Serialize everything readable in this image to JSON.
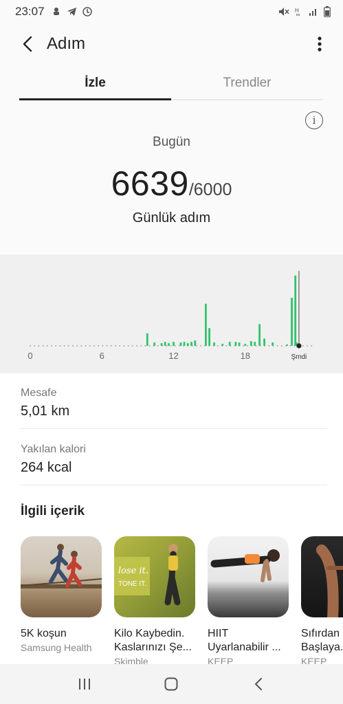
{
  "status_bar": {
    "time": "23:07"
  },
  "header": {
    "title": "Adım"
  },
  "tabs": [
    {
      "label": "İzle"
    },
    {
      "label": "Trendler"
    }
  ],
  "summary": {
    "today_label": "Bugün",
    "steps": "6639",
    "goal": "/6000",
    "subtitle": "Günlük adım"
  },
  "chart_data": {
    "type": "bar",
    "x_ticks": [
      "0",
      "6",
      "12",
      "18",
      "Şmdi"
    ],
    "x_tick_hours": [
      0,
      6,
      12,
      18,
      22.5
    ],
    "hour_range": [
      0,
      24
    ],
    "now_hour": 22.5,
    "bars": [
      {
        "hour": 9.8,
        "value": 19
      },
      {
        "hour": 10.4,
        "value": 5
      },
      {
        "hour": 11.0,
        "value": 4
      },
      {
        "hour": 11.3,
        "value": 6
      },
      {
        "hour": 11.6,
        "value": 4
      },
      {
        "hour": 12.0,
        "value": 6
      },
      {
        "hour": 12.6,
        "value": 5
      },
      {
        "hour": 12.9,
        "value": 6
      },
      {
        "hour": 13.2,
        "value": 4
      },
      {
        "hour": 13.5,
        "value": 6
      },
      {
        "hour": 13.8,
        "value": 8
      },
      {
        "hour": 14.7,
        "value": 64
      },
      {
        "hour": 15.0,
        "value": 27
      },
      {
        "hour": 15.4,
        "value": 5
      },
      {
        "hour": 16.1,
        "value": 3
      },
      {
        "hour": 16.7,
        "value": 6
      },
      {
        "hour": 17.2,
        "value": 6
      },
      {
        "hour": 17.5,
        "value": 5
      },
      {
        "hour": 18.0,
        "value": 3
      },
      {
        "hour": 18.5,
        "value": 7
      },
      {
        "hour": 18.8,
        "value": 6
      },
      {
        "hour": 19.2,
        "value": 33
      },
      {
        "hour": 19.6,
        "value": 11
      },
      {
        "hour": 20.3,
        "value": 5
      },
      {
        "hour": 21.5,
        "value": 2
      },
      {
        "hour": 21.9,
        "value": 73
      },
      {
        "hour": 22.2,
        "value": 107
      },
      {
        "hour": 22.3,
        "value": 5
      }
    ],
    "bar_color": "#2ec46a"
  },
  "metrics": [
    {
      "label": "Mesafe",
      "value": "5,01 km"
    },
    {
      "label": "Yakılan kalori",
      "value": "264 kcal"
    }
  ],
  "related": {
    "title": "İlgili içerik",
    "cards": [
      {
        "title": "5K koşun",
        "source": "Samsung Health",
        "thumb_text": ""
      },
      {
        "title": "Kilo Kaybedin. Kaslarınızı Şe...",
        "source": "Skimble",
        "thumb_text": "lose it. TONE IT."
      },
      {
        "title": "HIIT Uyarlanabilir ...",
        "source": "KEEP",
        "thumb_text": ""
      },
      {
        "title": "Sıfırdan Başlaya...",
        "source": "KEEP",
        "thumb_text": ""
      }
    ]
  },
  "colors": {
    "accent_green": "#2ec46a",
    "background": "#fafafa"
  }
}
